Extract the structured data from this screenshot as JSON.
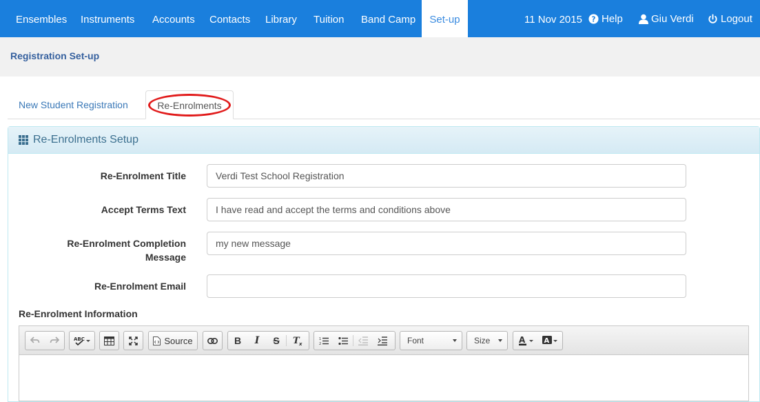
{
  "nav": {
    "items": [
      "Ensembles",
      "Instruments",
      "Accounts",
      "Contacts",
      "Library",
      "Tuition",
      "Band Camp",
      "Set-up"
    ],
    "active": "Set-up",
    "date": "11 Nov 2015",
    "help": "Help",
    "user": "Giu Verdi",
    "logout": "Logout",
    "color": "#1a7fdd"
  },
  "page": {
    "title": "Registration Set-up"
  },
  "tabs": [
    {
      "label": "New Student Registration"
    },
    {
      "label": "Re-Enrolments"
    }
  ],
  "panel": {
    "title": "Re-Enrolments Setup",
    "fields": [
      {
        "label": "Re-Enrolment Title",
        "value": "Verdi Test School Registration"
      },
      {
        "label": "Accept Terms Text",
        "value": "I have read and accept the terms and conditions above"
      },
      {
        "label_line1": "Re-Enrolment Completion",
        "label_line2": "Message",
        "value": "my new message"
      },
      {
        "label": "Re-Enrolment Email",
        "value": ""
      }
    ],
    "info_label": "Re-Enrolment Information"
  },
  "editor": {
    "source_label": "Source",
    "font_label": "Font",
    "size_label": "Size",
    "icons": [
      "undo-icon",
      "redo-icon",
      "spellcheck-icon",
      "table-icon",
      "maximize-icon",
      "source-icon",
      "link-icon",
      "bold-icon",
      "italic-icon",
      "strike-icon",
      "remove-format-icon",
      "numbered-list-icon",
      "bulleted-list-icon",
      "outdent-icon",
      "indent-icon",
      "text-color-icon",
      "background-color-icon"
    ]
  }
}
